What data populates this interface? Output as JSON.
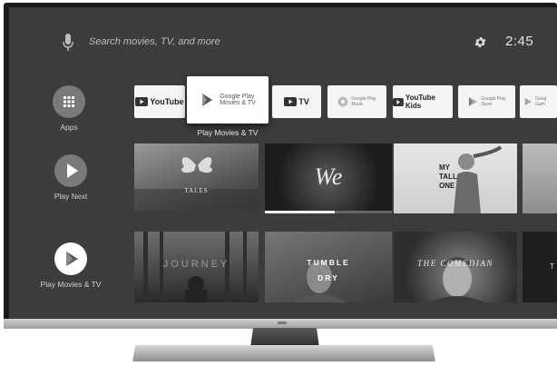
{
  "topbar": {
    "search_placeholder": "Search movies, TV, and more",
    "time": "2:45"
  },
  "sidebar": {
    "items": [
      {
        "label": "Apps",
        "icon": "apps-grid-icon"
      },
      {
        "label": "Play Next",
        "icon": "play-icon"
      },
      {
        "label": "Play Movies & TV",
        "icon": "play-movies-icon"
      }
    ]
  },
  "apps_row": {
    "focused_label": "Play Movies & TV",
    "focused_tile_line1": "Google Play",
    "focused_tile_line2": "Movies & TV",
    "tiles": [
      {
        "text": "YouTube"
      },
      {
        "text": "TV"
      },
      {
        "line1": "Google Play",
        "line2": "Music"
      },
      {
        "text": "YouTube Kids"
      },
      {
        "line1": "Google Play",
        "line2": "Store"
      },
      {
        "line1": "Goog",
        "line2": "Gam"
      }
    ]
  },
  "play_next_row": {
    "items": [
      {
        "title": "TALES"
      },
      {
        "title": "We"
      },
      {
        "title_lines": [
          "MY",
          "TALL",
          "ONE"
        ]
      },
      {
        "title": ""
      }
    ],
    "progress": 0.55
  },
  "movies_row": {
    "items": [
      {
        "title": "JOURNEY"
      },
      {
        "title_lines": [
          "TUMBLE",
          "DRY"
        ]
      },
      {
        "title": "THE COMEDIAN"
      },
      {
        "title": "T"
      }
    ]
  }
}
